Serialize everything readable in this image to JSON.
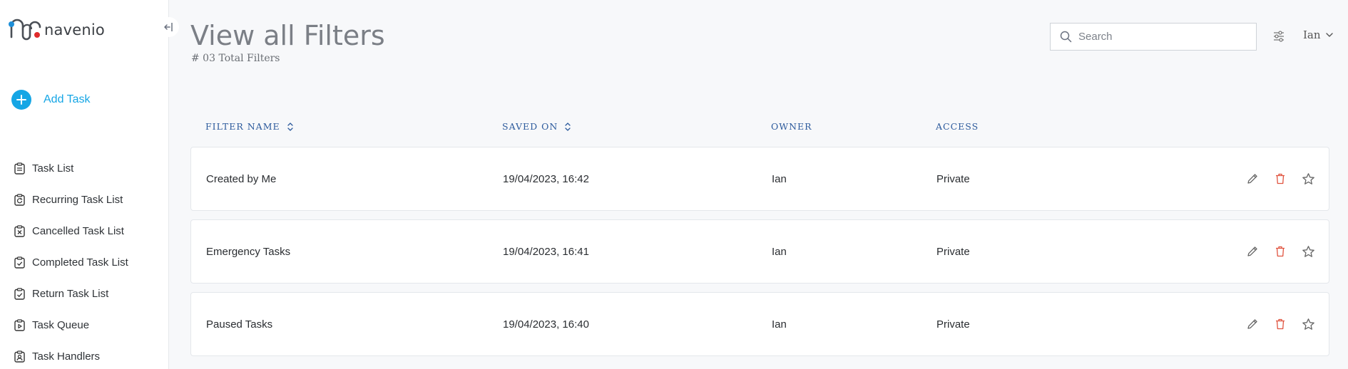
{
  "brand": {
    "name": "navenio"
  },
  "sidebar": {
    "add_task_label": "Add Task",
    "items": [
      {
        "label": "Task List",
        "icon": "clipboard-list-icon"
      },
      {
        "label": "Recurring Task List",
        "icon": "clipboard-recurring-icon"
      },
      {
        "label": "Cancelled Task List",
        "icon": "clipboard-cancel-icon"
      },
      {
        "label": "Completed Task List",
        "icon": "clipboard-check-icon"
      },
      {
        "label": "Return Task List",
        "icon": "clipboard-return-icon"
      },
      {
        "label": "Task Queue",
        "icon": "clipboard-queue-icon"
      },
      {
        "label": "Task Handlers",
        "icon": "clipboard-user-icon"
      }
    ]
  },
  "header": {
    "title": "View all Filters",
    "subtitle": "# 03 Total Filters",
    "search_placeholder": "Search",
    "user_name": "Ian"
  },
  "table": {
    "columns": {
      "filter_name": "FILTER NAME",
      "saved_on": "SAVED ON",
      "owner": "OWNER",
      "access": "ACCESS"
    },
    "rows": [
      {
        "name": "Created by Me",
        "saved_on": "19/04/2023, 16:42",
        "owner": "Ian",
        "access": "Private"
      },
      {
        "name": "Emergency Tasks",
        "saved_on": "19/04/2023, 16:41",
        "owner": "Ian",
        "access": "Private"
      },
      {
        "name": "Paused Tasks",
        "saved_on": "19/04/2023, 16:40",
        "owner": "Ian",
        "access": "Private"
      }
    ]
  },
  "colors": {
    "accent": "#16a6e5",
    "header_text": "#2c5a9c",
    "delete": "#e0533f",
    "logo_blue": "#1e8fd8",
    "logo_red": "#e02b2b"
  }
}
